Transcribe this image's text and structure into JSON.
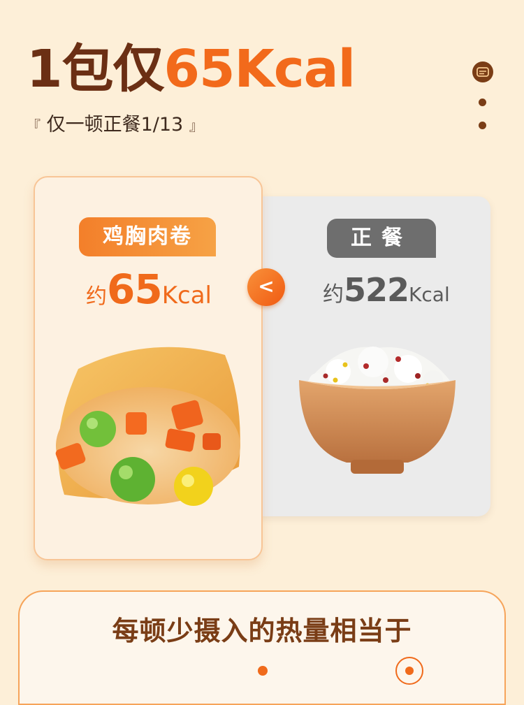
{
  "header": {
    "title_prefix": "1包仅",
    "title_highlight": "65Kcal",
    "subtitle_open": "『",
    "subtitle_text": "仅一顿正餐1/13",
    "subtitle_close": "』"
  },
  "comparison": {
    "left": {
      "tag": "鸡胸肉卷",
      "prefix": "约",
      "value": "65",
      "unit": "Kcal"
    },
    "right": {
      "tag": "正餐",
      "prefix": "约",
      "value": "522",
      "unit": "Kcal"
    },
    "vs_symbol": "<"
  },
  "footer": {
    "title": "每顿少摄入的热量相当于"
  },
  "colors": {
    "accent": "#f26a1b",
    "brown": "#6b2f14",
    "gray": "#6e6e6e",
    "background": "#fdefd8"
  }
}
